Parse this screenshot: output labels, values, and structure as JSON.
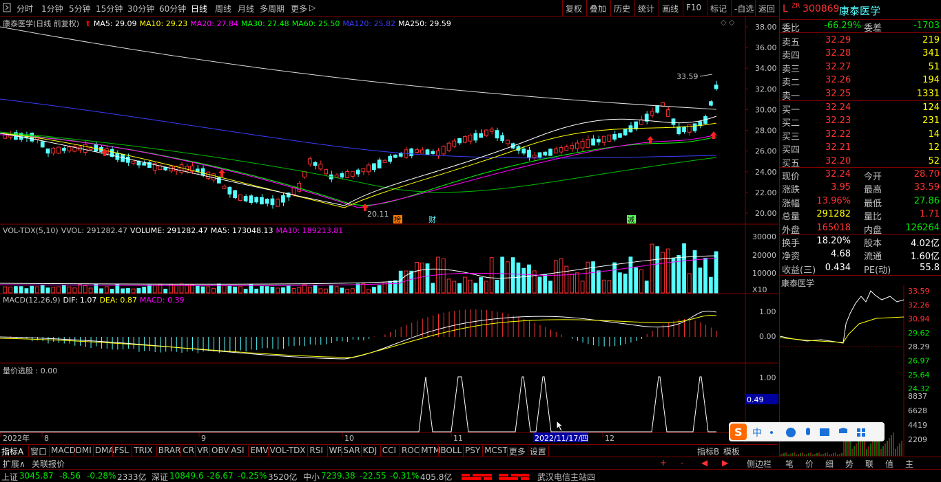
{
  "toolbar": {
    "periods": [
      "分时",
      "1分钟",
      "5分钟",
      "15分钟",
      "30分钟",
      "60分钟",
      "日线",
      "周线",
      "月线",
      "多周期",
      "更多"
    ],
    "active_period": "日线",
    "more_arrow": "▷",
    "actions": [
      "复权",
      "叠加",
      "历史",
      "统计",
      "画线",
      "F10",
      "标记",
      "-自选",
      "返回"
    ]
  },
  "main_legend": {
    "title": "康泰医学(日线 前复权)",
    "items": [
      {
        "label": "MA5: 29.09",
        "color": "#ffffff"
      },
      {
        "label": "MA10: 29.23",
        "color": "#ffff00"
      },
      {
        "label": "MA20: 27.84",
        "color": "#ff00ff"
      },
      {
        "label": "MA30: 27.48",
        "color": "#00ff00"
      },
      {
        "label": "MA60: 25.50",
        "color": "#00ff00"
      },
      {
        "label": "MA120: 25.82",
        "color": "#3c3cff"
      },
      {
        "label": "MA250: 29.59",
        "color": "#ffffff"
      }
    ],
    "diamonds": "◇ ◇"
  },
  "price_axis": [
    "38.00",
    "36.00",
    "34.00",
    "32.00",
    "30.00",
    "28.00",
    "26.00",
    "24.00",
    "22.00",
    "20.00"
  ],
  "annotations": {
    "high": "33.59",
    "low": "20.11",
    "tag_bang": "榜",
    "tag_cai": "财",
    "tag_jian": "减"
  },
  "vol_legend": {
    "items": [
      {
        "label": "VOL-TDX(5,10)",
        "color": "#c0c0c0"
      },
      {
        "label": "VVOL: 291282.47",
        "color": "#c0c0c0"
      },
      {
        "label": "VOLUME: 291282.47",
        "color": "#ffffff"
      },
      {
        "label": "MA5: 173048.13",
        "color": "#ffffff"
      },
      {
        "label": "MA10: 189213.81",
        "color": "#ff00ff"
      }
    ]
  },
  "vol_axis": [
    "30000",
    "20000",
    "10000",
    "X10"
  ],
  "macd_legend": {
    "items": [
      {
        "label": "MACD(12,26,9)",
        "color": "#c0c0c0"
      },
      {
        "label": "DIF: 1.07",
        "color": "#ffffff"
      },
      {
        "label": "DEA: 0.87",
        "color": "#ffff00"
      },
      {
        "label": "MACD: 0.39",
        "color": "#ff00ff"
      }
    ]
  },
  "macd_axis": [
    "1.00",
    "0.00"
  ],
  "lj_legend": {
    "label": "量价选股 : 0.00"
  },
  "lj_axis": [
    "1.00",
    "0.49"
  ],
  "date_axis": {
    "labels": [
      "2022年",
      "8",
      "9",
      "10",
      "11",
      "12"
    ],
    "cursor_date": "2022/11/17/四"
  },
  "bottom_tabs": [
    "指标A",
    "窗口",
    "MACD",
    "DMI",
    "DMA",
    "FSL",
    "TRIX",
    "BRAR",
    "CR",
    "VR",
    "OBV",
    "ASI",
    "EMV",
    "VOL-TDX",
    "RSI",
    "WR",
    "SAR",
    "KDJ",
    "CCI",
    "ROC",
    "MTM",
    "BOLL",
    "PSY",
    "MCST",
    "更多",
    "设置"
  ],
  "bottom_right_tabs": [
    "指标B",
    "模板"
  ],
  "bottom_arrows": [
    "+",
    "-",
    "◀",
    "▶"
  ],
  "stock": {
    "code": "300869",
    "name": "康泰医学",
    "prefix": "L",
    "super": "ZR"
  },
  "committee": {
    "label1": "委比",
    "value1": "-66.29%",
    "label2": "委差",
    "value2": "-1703"
  },
  "sell": [
    {
      "label": "卖五",
      "price": "32.29",
      "vol": "219"
    },
    {
      "label": "卖四",
      "price": "32.28",
      "vol": "341"
    },
    {
      "label": "卖三",
      "price": "32.27",
      "vol": "51"
    },
    {
      "label": "卖二",
      "price": "32.26",
      "vol": "194"
    },
    {
      "label": "卖一",
      "price": "32.25",
      "vol": "1331"
    }
  ],
  "buy": [
    {
      "label": "买一",
      "price": "32.24",
      "vol": "124"
    },
    {
      "label": "买二",
      "price": "32.23",
      "vol": "231"
    },
    {
      "label": "买三",
      "price": "32.22",
      "vol": "14"
    },
    {
      "label": "买四",
      "price": "32.21",
      "vol": "12"
    },
    {
      "label": "买五",
      "price": "32.20",
      "vol": "52"
    }
  ],
  "quote": [
    {
      "l1": "现价",
      "v1": "32.24",
      "c1": "#ff3232",
      "l2": "今开",
      "v2": "28.70",
      "c2": "#ff3232"
    },
    {
      "l1": "涨跌",
      "v1": "3.95",
      "c1": "#ff3232",
      "l2": "最高",
      "v2": "33.59",
      "c2": "#ff3232"
    },
    {
      "l1": "涨幅",
      "v1": "13.96%",
      "c1": "#ff3232",
      "l2": "最低",
      "v2": "27.86",
      "c2": "#00e600"
    },
    {
      "l1": "总量",
      "v1": "291282",
      "c1": "#ffff00",
      "l2": "量比",
      "v2": "1.71",
      "c2": "#ff3232"
    },
    {
      "l1": "外盘",
      "v1": "165018",
      "c1": "#ff3232",
      "l2": "内盘",
      "v2": "126264",
      "c2": "#00e600"
    }
  ],
  "fund": [
    {
      "l1": "换手",
      "v1": "18.20%",
      "l2": "股本",
      "v2": "4.02亿"
    },
    {
      "l1": "净资",
      "v1": "4.68",
      "l2": "流通",
      "v2": "1.60亿"
    },
    {
      "l1": "收益(三)",
      "v1": "0.434",
      "l2": "PE(动)",
      "v2": "55.8"
    }
  ],
  "mini_chart": {
    "title": "康泰医学",
    "price_labels": [
      "33.59",
      "32.26",
      "30.94",
      "29.62",
      "28.29",
      "26.97",
      "25.64",
      "24.32"
    ],
    "vol_labels": [
      "8837",
      "6628",
      "4419",
      "2209"
    ]
  },
  "side_tabs": [
    "侧边栏",
    "笔",
    "价",
    "细",
    "势",
    "联",
    "值",
    "主"
  ],
  "status_row1": {
    "expand": "扩展∧",
    "link": "关联报价"
  },
  "status_row2": {
    "sh_label": "上证",
    "sh_val": "3045.87",
    "sh_chg": "-8.56",
    "sh_pct": "-0.28%",
    "sh_amt": "2333亿",
    "sz_label": "深证",
    "sz_val": "10849.6",
    "sz_chg": "-26.67",
    "sz_pct": "-0.25%",
    "sz_amt": "3520亿",
    "zx_label": "中小",
    "zx_val": "7239.38",
    "zx_chg": "-22.55",
    "zx_pct": "-0.31%",
    "zx_amt": "405.8亿",
    "server": "武汉电信主站四"
  },
  "ime": {
    "label": "中"
  }
}
